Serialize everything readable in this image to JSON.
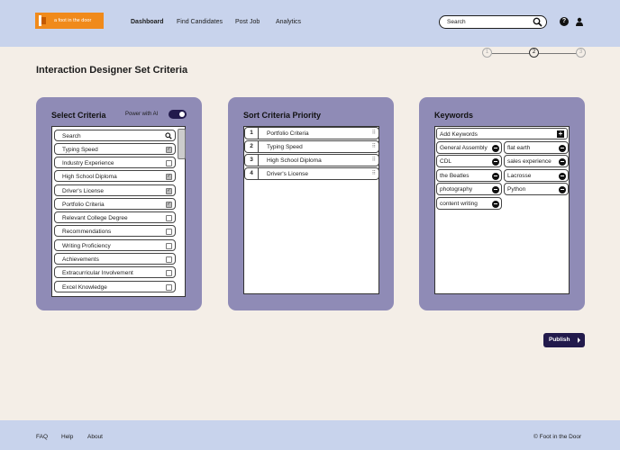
{
  "header": {
    "logo_text": "a foot in the door",
    "nav": [
      "Dashboard",
      "Find Candidates",
      "Post Job",
      "Analytics"
    ],
    "search_placeholder": "Search",
    "help_glyph": "?"
  },
  "stepper": {
    "steps": [
      "1",
      "2",
      "3"
    ],
    "current": 2
  },
  "page_title": "Interaction Designer Set Criteria",
  "select_criteria": {
    "title": "Select Criteria",
    "ai_label": "Power with AI",
    "ai_enabled": true,
    "search_placeholder": "Search",
    "items": [
      {
        "label": "Typing Speed",
        "checked": true
      },
      {
        "label": "Industry Experience",
        "checked": false
      },
      {
        "label": "High School Diploma",
        "checked": true
      },
      {
        "label": "Driver's License",
        "checked": true
      },
      {
        "label": "Portfolio Criteria",
        "checked": true
      },
      {
        "label": "Relevant College Degree",
        "checked": false
      },
      {
        "label": "Recommendations",
        "checked": false
      },
      {
        "label": "Writing Proficiency",
        "checked": false
      },
      {
        "label": "Achievements",
        "checked": false
      },
      {
        "label": "Extracurricular Involvement",
        "checked": false
      },
      {
        "label": "Excel Knowledge",
        "checked": false
      }
    ]
  },
  "sort_priority": {
    "title": "Sort Criteria Priority",
    "items": [
      {
        "num": "1",
        "label": "Portfolio Criteria"
      },
      {
        "num": "2",
        "label": "Typing Speed"
      },
      {
        "num": "3",
        "label": "High School Diploma"
      },
      {
        "num": "4",
        "label": "Driver's License"
      }
    ]
  },
  "keywords": {
    "title": "Keywords",
    "add_label": "Add Keywords",
    "left": [
      "General Assembly",
      "CDL",
      "the Beatles",
      "photography",
      "content writing"
    ],
    "right": [
      "flat earth",
      "sales experience",
      "Lacrosse",
      "Python"
    ]
  },
  "publish_label": "Publish",
  "footer": {
    "links": [
      "FAQ",
      "Help",
      "About"
    ],
    "copyright": "© Foot in the Door"
  },
  "colors": {
    "header": "#c8d3ec",
    "panel": "#8f8bb6",
    "accent": "#221a4c",
    "logo": "#f08a1b",
    "page": "#f4eee7"
  }
}
